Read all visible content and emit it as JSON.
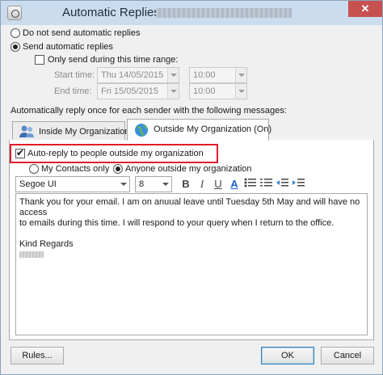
{
  "window": {
    "title": "Automatic Replies -",
    "close_label": "✕"
  },
  "options": {
    "do_not_send": "Do not send automatic replies",
    "send_auto": "Send automatic replies",
    "only_send_range": "Only send during this time range:",
    "start_time_label": "Start time:",
    "end_time_label": "End time:",
    "start_date": "Thu 14/05/2015",
    "start_hour": "10:00",
    "end_date": "Fri 15/05/2015",
    "end_hour": "10:00",
    "selected": "send_auto",
    "time_range_checked": false
  },
  "instruction": "Automatically reply once for each sender with the following messages:",
  "tabs": [
    {
      "label": "Inside My Organization",
      "icon": "people-icon",
      "active": false
    },
    {
      "label": "Outside My Organization (On)",
      "icon": "globe-icon",
      "active": true
    }
  ],
  "outside": {
    "auto_reply_label": "Auto-reply to people outside my organization",
    "auto_reply_checked": true,
    "my_contacts_label": "My Contacts only",
    "anyone_label": "Anyone outside my organization",
    "audience_selected": "anyone"
  },
  "toolbar": {
    "font_name": "Segoe UI",
    "font_size": "8",
    "bold": "B",
    "italic": "I",
    "underline": "U",
    "font_color": "A",
    "font_color_hex": "#1f5fd6"
  },
  "message": {
    "line1": "Thank you for your email. I am on anuual leave until Tuesday 5th May and will have no access",
    "line2": "to emails during this time. I will respond to your query when I return to the office.",
    "line3": "Kind Regards"
  },
  "footer": {
    "rules_label": "Rules...",
    "ok_label": "OK",
    "cancel_label": "Cancel"
  },
  "colors": {
    "highlight_box": "#e01c2b",
    "titlebar": "#cbdcef",
    "close_button": "#c75050"
  }
}
